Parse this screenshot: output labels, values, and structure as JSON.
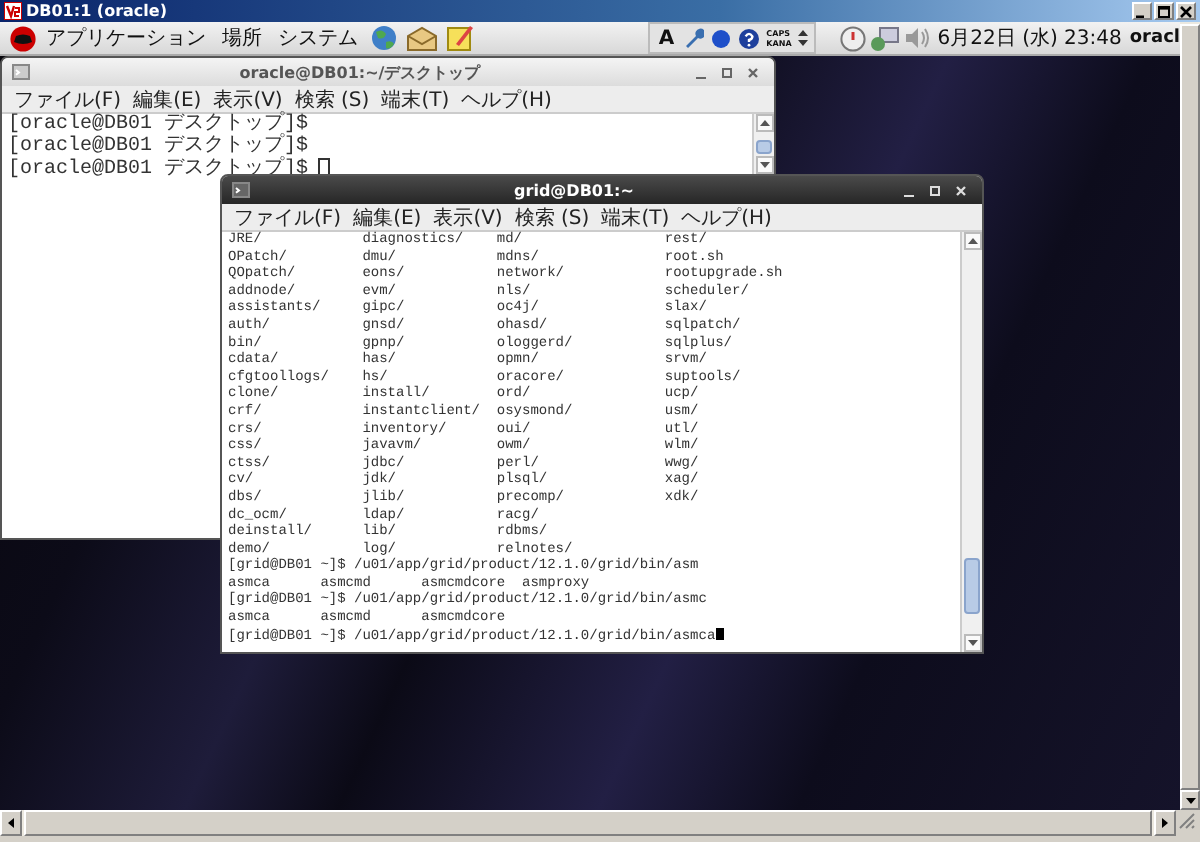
{
  "viewer": {
    "title": "DB01:1 (oracle)"
  },
  "panel": {
    "menus": [
      "アプリケーション",
      "場所",
      "システム"
    ],
    "input_mode": "A",
    "caps_label": "CAPS",
    "kana_label": "KANA",
    "clock": "6月22日 (水) 23:48",
    "user": "oracl"
  },
  "windows": [
    {
      "title": "oracle@DB01:~/デスクトップ",
      "active": false,
      "menu": [
        "ファイル(F)",
        "編集(E)",
        "表示(V)",
        "検索 (S)",
        "端末(T)",
        "ヘルプ(H)"
      ],
      "lines": [
        "[oracle@DB01 デスクトップ]$",
        "[oracle@DB01 デスクトップ]$",
        "[oracle@DB01 デスクトップ]$"
      ]
    },
    {
      "title": "grid@DB01:~",
      "active": true,
      "menu": [
        "ファイル(F)",
        "編集(E)",
        "表示(V)",
        "検索 (S)",
        "端末(T)",
        "ヘルプ(H)"
      ],
      "listing": [
        [
          "JRE/",
          "diagnostics/",
          "md/",
          "rest/"
        ],
        [
          "OPatch/",
          "dmu/",
          "mdns/",
          "root.sh"
        ],
        [
          "QOpatch/",
          "eons/",
          "network/",
          "rootupgrade.sh"
        ],
        [
          "addnode/",
          "evm/",
          "nls/",
          "scheduler/"
        ],
        [
          "assistants/",
          "gipc/",
          "oc4j/",
          "slax/"
        ],
        [
          "auth/",
          "gnsd/",
          "ohasd/",
          "sqlpatch/"
        ],
        [
          "bin/",
          "gpnp/",
          "ologgerd/",
          "sqlplus/"
        ],
        [
          "cdata/",
          "has/",
          "opmn/",
          "srvm/"
        ],
        [
          "cfgtoollogs/",
          "hs/",
          "oracore/",
          "suptools/"
        ],
        [
          "clone/",
          "install/",
          "ord/",
          "ucp/"
        ],
        [
          "crf/",
          "instantclient/",
          "osysmond/",
          "usm/"
        ],
        [
          "crs/",
          "inventory/",
          "oui/",
          "utl/"
        ],
        [
          "css/",
          "javavm/",
          "owm/",
          "wlm/"
        ],
        [
          "ctss/",
          "jdbc/",
          "perl/",
          "wwg/"
        ],
        [
          "cv/",
          "jdk/",
          "plsql/",
          "xag/"
        ],
        [
          "dbs/",
          "jlib/",
          "precomp/",
          "xdk/"
        ],
        [
          "dc_ocm/",
          "ldap/",
          "racg/"
        ],
        [
          "deinstall/",
          "lib/",
          "rdbms/"
        ],
        [
          "demo/",
          "log/",
          "relnotes/"
        ]
      ],
      "lines": [
        "[grid@DB01 ~]$ /u01/app/grid/product/12.1.0/grid/bin/asm",
        "asmca      asmcmd      asmcmdcore  asmproxy",
        "[grid@DB01 ~]$ /u01/app/grid/product/12.1.0/grid/bin/asmc",
        "asmca      asmcmd      asmcmdcore",
        "[grid@DB01 ~]$ /u01/app/grid/product/12.1.0/grid/bin/asmca"
      ]
    }
  ]
}
